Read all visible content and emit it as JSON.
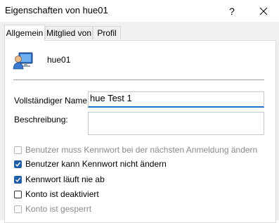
{
  "window": {
    "title": "Eigenschaften von hue01",
    "help_label": "?"
  },
  "tabs": [
    {
      "label": "Allgemein",
      "active": true
    },
    {
      "label": "Mitglied von",
      "active": false
    },
    {
      "label": "Profil",
      "active": false
    }
  ],
  "general": {
    "username": "hue01",
    "fullname_label": "Vollständiger Name:",
    "fullname_value": "hue Test 1",
    "description_label": "Beschreibung:",
    "description_value": ""
  },
  "options": [
    {
      "label": "Benutzer muss Kennwort bei der nächsten Anmeldung ändern",
      "checked": false,
      "enabled": false
    },
    {
      "label": "Benutzer kann Kennwort nicht ändern",
      "checked": true,
      "enabled": true
    },
    {
      "label": "Kennwort läuft nie ab",
      "checked": true,
      "enabled": true
    },
    {
      "label": "Konto ist deaktiviert",
      "checked": false,
      "enabled": true
    },
    {
      "label": "Konto ist gesperrt",
      "checked": false,
      "enabled": false
    }
  ],
  "colors": {
    "accent": "#1f5fa8",
    "disabled_text": "#8a8a8a"
  }
}
